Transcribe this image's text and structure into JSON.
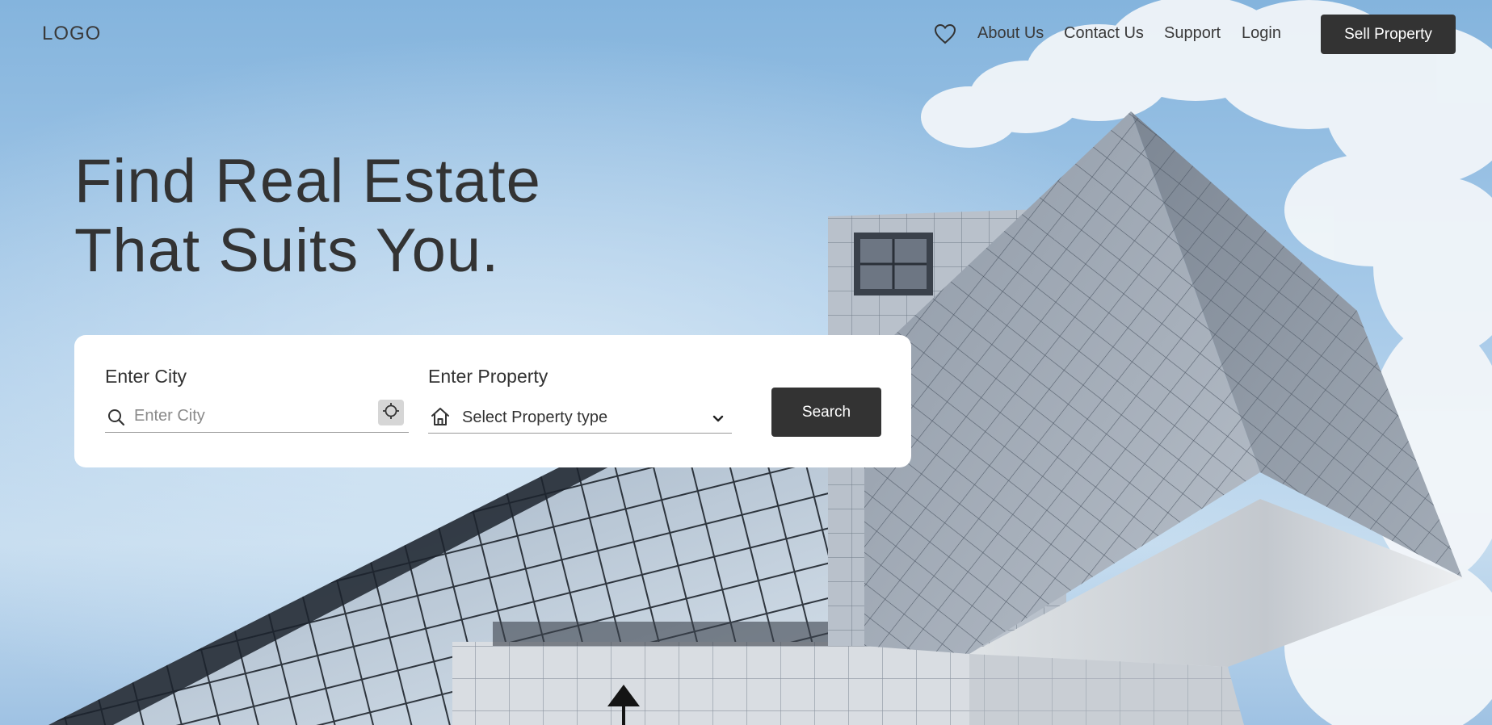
{
  "nav": {
    "logo": "LOGO",
    "favorites_icon": "heart-icon",
    "links": [
      "About Us",
      "Contact Us",
      "Support",
      "Login"
    ],
    "cta_label": "Sell Property"
  },
  "hero": {
    "title_line1": "Find Real Estate",
    "title_line2": "That Suits You."
  },
  "search": {
    "city_label": "Enter City",
    "city_placeholder": "Enter City",
    "city_value": "",
    "city_icon": "search-icon",
    "locate_icon": "crosshair-icon",
    "property_label": "Enter Property",
    "property_selected": "Select Property type",
    "property_icon": "home-icon",
    "dropdown_icon": "chevron-down-icon",
    "submit_label": "Search"
  },
  "colors": {
    "primary_dark": "#333333",
    "sky": "#9fc5e6",
    "card": "#ffffff"
  }
}
